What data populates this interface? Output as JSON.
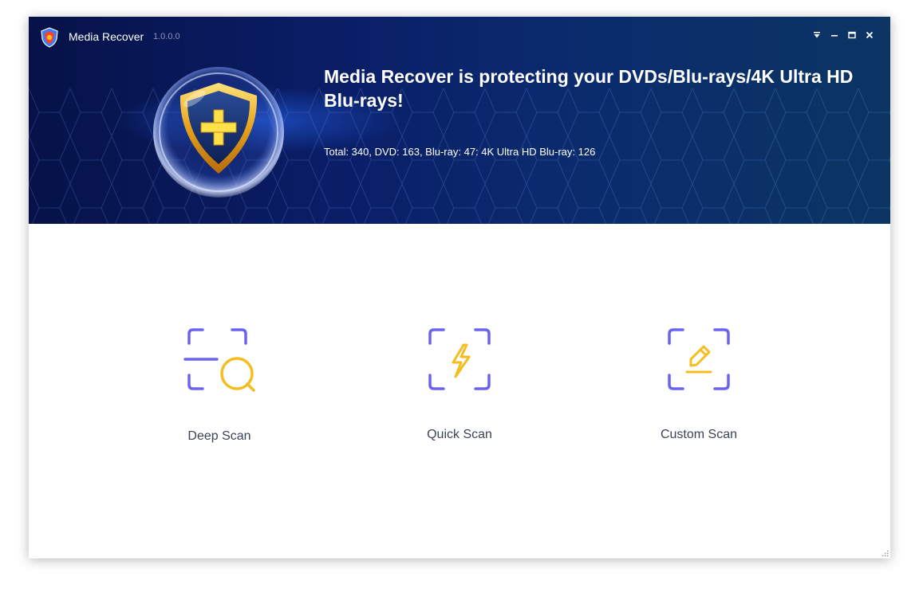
{
  "app": {
    "name": "Media Recover",
    "version": "1.0.0.0"
  },
  "banner": {
    "headline": "Media Recover is protecting your DVDs/Blu-rays/4K Ultra HD Blu-rays!",
    "stats": "Total: 340, DVD: 163, Blu-ray: 47: 4K Ultra HD Blu-ray: 126"
  },
  "scan_options": [
    {
      "label": "Deep Scan",
      "icon": "deep-scan-icon"
    },
    {
      "label": "Quick Scan",
      "icon": "quick-scan-icon"
    },
    {
      "label": "Custom Scan",
      "icon": "custom-scan-icon"
    }
  ],
  "window_controls": [
    "menu-icon",
    "minimize-icon",
    "maximize-icon",
    "close-icon"
  ],
  "colors": {
    "banner_dark": "#061248",
    "banner_light": "#0b3563",
    "frame_purple": "#6b63f0",
    "accent_yellow": "#f5bd1f",
    "label_text": "#3a4356"
  }
}
